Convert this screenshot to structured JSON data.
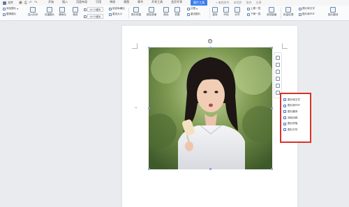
{
  "menubar": {
    "file_label": "文件",
    "tabs": [
      "开始",
      "插入",
      "页面布局",
      "引用",
      "审阅",
      "视图",
      "章节",
      "开发工具",
      "会员专享",
      "图片工具"
    ],
    "active_tab": "图片工具",
    "search_label": "查找命令",
    "tools": [
      "未同步",
      "协作",
      "分享"
    ]
  },
  "ribbon": {
    "add_picture": "添加图片",
    "replace_picture": "替换图片",
    "insert_shape": "插入形状",
    "compress": "压缩图片",
    "clarity": "清晰化",
    "crop": "裁剪",
    "height_value": "14.03厘米",
    "width_value": "14.03厘米",
    "lock_ratio": "锁定纵横比",
    "reset_size": "重设大小",
    "picture_fix": "照片修复",
    "matting": "抠除背景",
    "set_transparent": "设置透明色",
    "color": "颜色",
    "effects": "效果",
    "reset": "重设样式",
    "border": "边框",
    "reset_picture": "重设图片",
    "rotate": "旋转",
    "wrap": "环绕",
    "align": "对齐",
    "up_layer": "上移一层",
    "down_layer": "下移一层",
    "select_pane": "选择窗格",
    "batch": "批量处理",
    "to_text": "图片转文字",
    "to_pdf": "图片转PDF",
    "translate": "图片翻译"
  },
  "popup": {
    "items": [
      "图片转文字",
      "图片转PDF",
      "图片翻译",
      "消除涂鸦",
      "图片拼接",
      "图片打印"
    ]
  }
}
